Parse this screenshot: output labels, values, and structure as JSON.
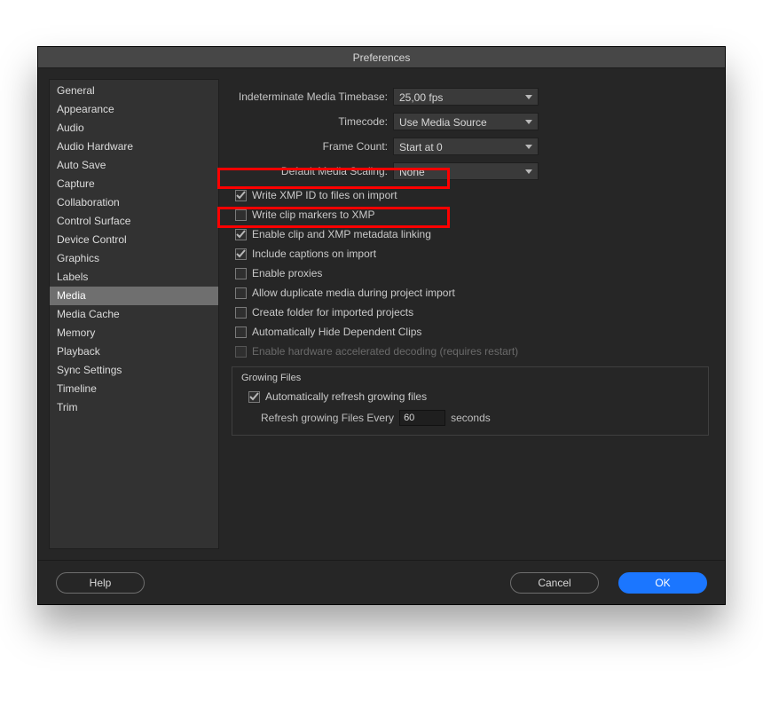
{
  "title": "Preferences",
  "sidebar": {
    "items": [
      {
        "label": "General"
      },
      {
        "label": "Appearance"
      },
      {
        "label": "Audio"
      },
      {
        "label": "Audio Hardware"
      },
      {
        "label": "Auto Save"
      },
      {
        "label": "Capture"
      },
      {
        "label": "Collaboration"
      },
      {
        "label": "Control Surface"
      },
      {
        "label": "Device Control"
      },
      {
        "label": "Graphics"
      },
      {
        "label": "Labels"
      },
      {
        "label": "Media",
        "selected": true
      },
      {
        "label": "Media Cache"
      },
      {
        "label": "Memory"
      },
      {
        "label": "Playback"
      },
      {
        "label": "Sync Settings"
      },
      {
        "label": "Timeline"
      },
      {
        "label": "Trim"
      }
    ]
  },
  "form": {
    "indeterminate_label": "Indeterminate Media Timebase:",
    "indeterminate_value": "25,00 fps",
    "timecode_label": "Timecode:",
    "timecode_value": "Use Media Source",
    "framecount_label": "Frame Count:",
    "framecount_value": "Start at 0",
    "scaling_label": "Default Media Scaling:",
    "scaling_value": "None"
  },
  "checks": {
    "write_xmp": "Write XMP ID to files on import",
    "write_markers": "Write clip markers to XMP",
    "enable_linking": "Enable clip and XMP metadata linking",
    "include_captions": "Include captions on import",
    "enable_proxies": "Enable proxies",
    "allow_dup": "Allow duplicate media during project import",
    "create_folder": "Create folder for imported projects",
    "auto_hide": "Automatically Hide Dependent Clips",
    "hw_decode": "Enable hardware accelerated decoding (requires restart)"
  },
  "group": {
    "title": "Growing Files",
    "auto_refresh": "Automatically refresh growing files",
    "refresh_label_a": "Refresh growing Files Every",
    "refresh_value": "60",
    "refresh_label_b": "seconds"
  },
  "buttons": {
    "help": "Help",
    "cancel": "Cancel",
    "ok": "OK"
  }
}
